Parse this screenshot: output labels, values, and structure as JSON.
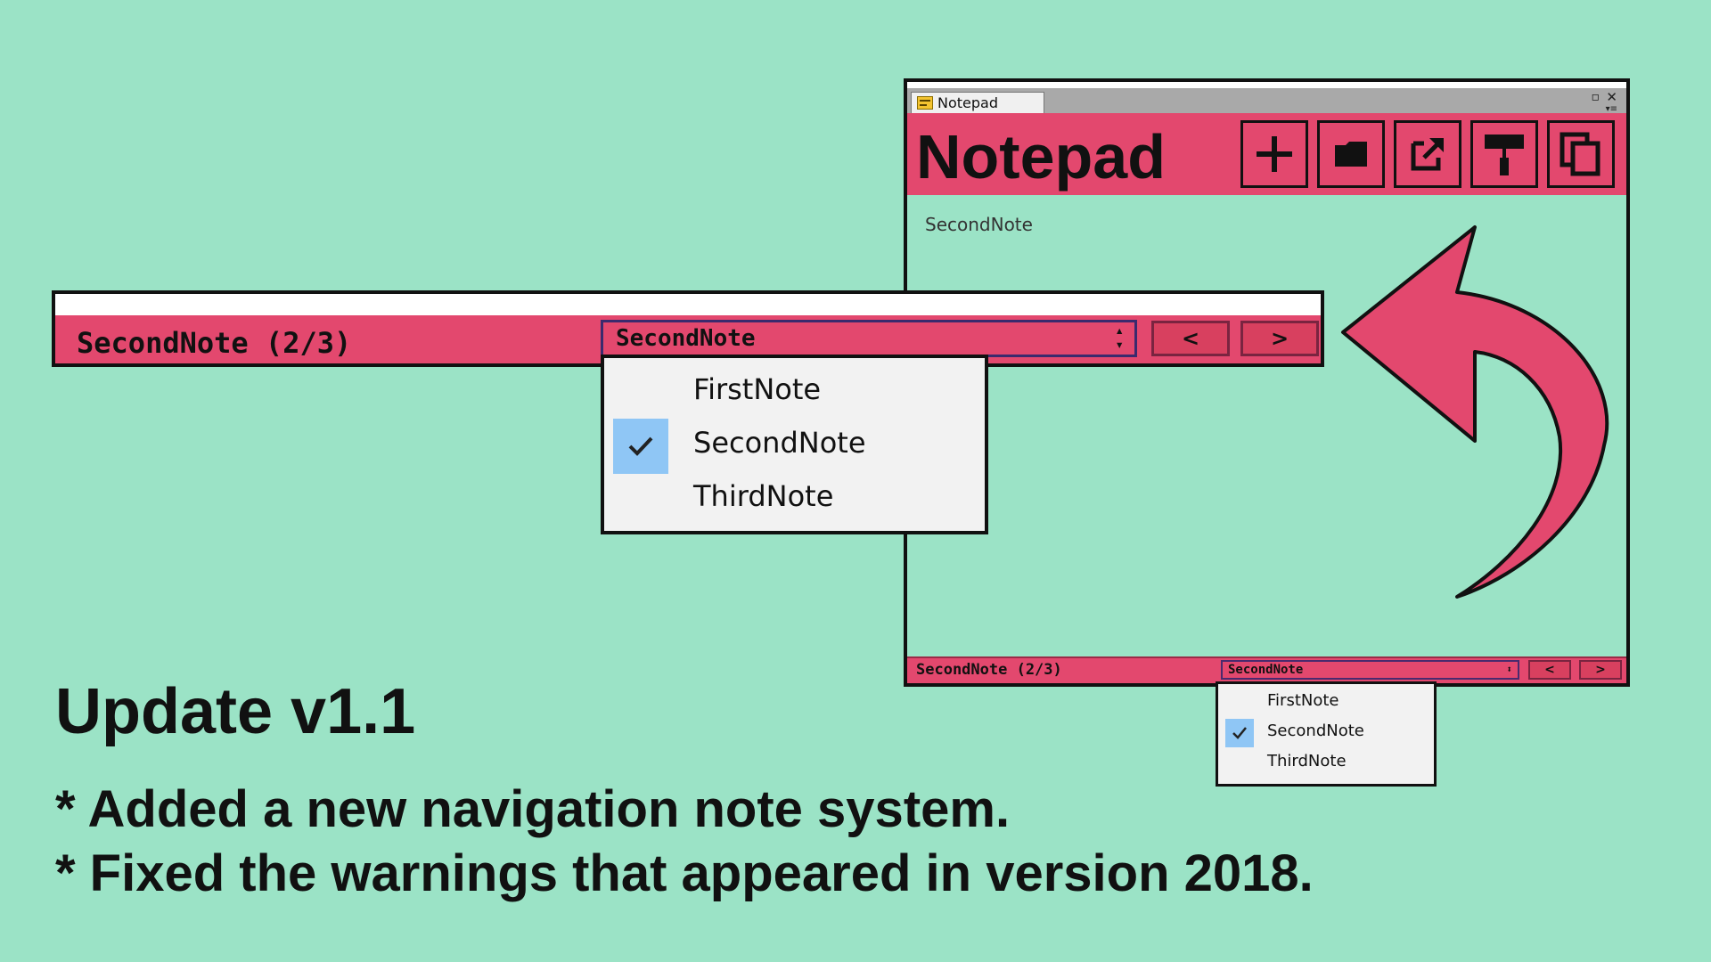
{
  "window": {
    "tab_label": "Notepad",
    "title": "Notepad",
    "current_note": "SecondNote",
    "toolbar": {
      "new_icon": "plus-icon",
      "open_icon": "folder-icon",
      "export_icon": "export-icon",
      "theme_icon": "paint-roller-icon",
      "copy_icon": "copy-icon"
    },
    "nav": {
      "label": "SecondNote (2/3)",
      "selected": "SecondNote",
      "prev": "<",
      "next": ">"
    },
    "dropdown": {
      "items": [
        "FirstNote",
        "SecondNote",
        "ThirdNote"
      ],
      "checked": "SecondNote"
    }
  },
  "zoom_nav": {
    "label": "SecondNote (2/3)",
    "selected": "SecondNote",
    "prev": "<",
    "next": ">",
    "dropdown": {
      "items": [
        "FirstNote",
        "SecondNote",
        "ThirdNote"
      ],
      "checked": "SecondNote"
    }
  },
  "caption": {
    "title": "Update v1.1",
    "lines": [
      "* Added a new navigation note system.",
      "* Fixed the warnings that appeared in version 2018."
    ]
  },
  "colors": {
    "background": "#9be3c6",
    "accent": "#e3486e",
    "selection": "#8fc6f5"
  }
}
